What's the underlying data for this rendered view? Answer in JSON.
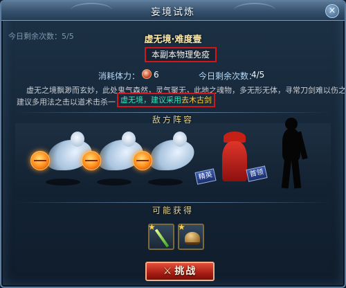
{
  "window": {
    "title": "妄境试炼",
    "close_glyph": "×"
  },
  "daily": {
    "remaining_text": "今日剩余次数：5/5"
  },
  "stage": {
    "name": "虚无境·难度壹",
    "immunity": "本副本物理免疫",
    "cost_label": "消耗体力：",
    "cost_value": "6",
    "attempts_label": "今日剩余次数：",
    "attempts_value": "4/5",
    "description_line1": "虚无之境飘渺而玄妙，此处鬼气森然，灵气聚无，此地之魂物，多无形无体，寻常刀剑难以伤之，",
    "description_line2": "建议多用法之击以道术击杀一",
    "tip_part1": "虚无境，建议采用",
    "tip_part2": "去木古剑"
  },
  "enemies": {
    "title": "敌方阵容",
    "tag_elite": "精英",
    "tag_boss": "首领"
  },
  "rewards": {
    "title": "可能获得",
    "items": [
      {
        "icon": "staff-icon"
      },
      {
        "icon": "helmet-icon"
      }
    ]
  },
  "actions": {
    "challenge_label": "挑战",
    "challenge_icon": "⚔"
  },
  "colors": {
    "highlight_box": "#d4161a",
    "tip_cyan": "#2ee8b8",
    "tip_gold": "#ffd23e"
  }
}
